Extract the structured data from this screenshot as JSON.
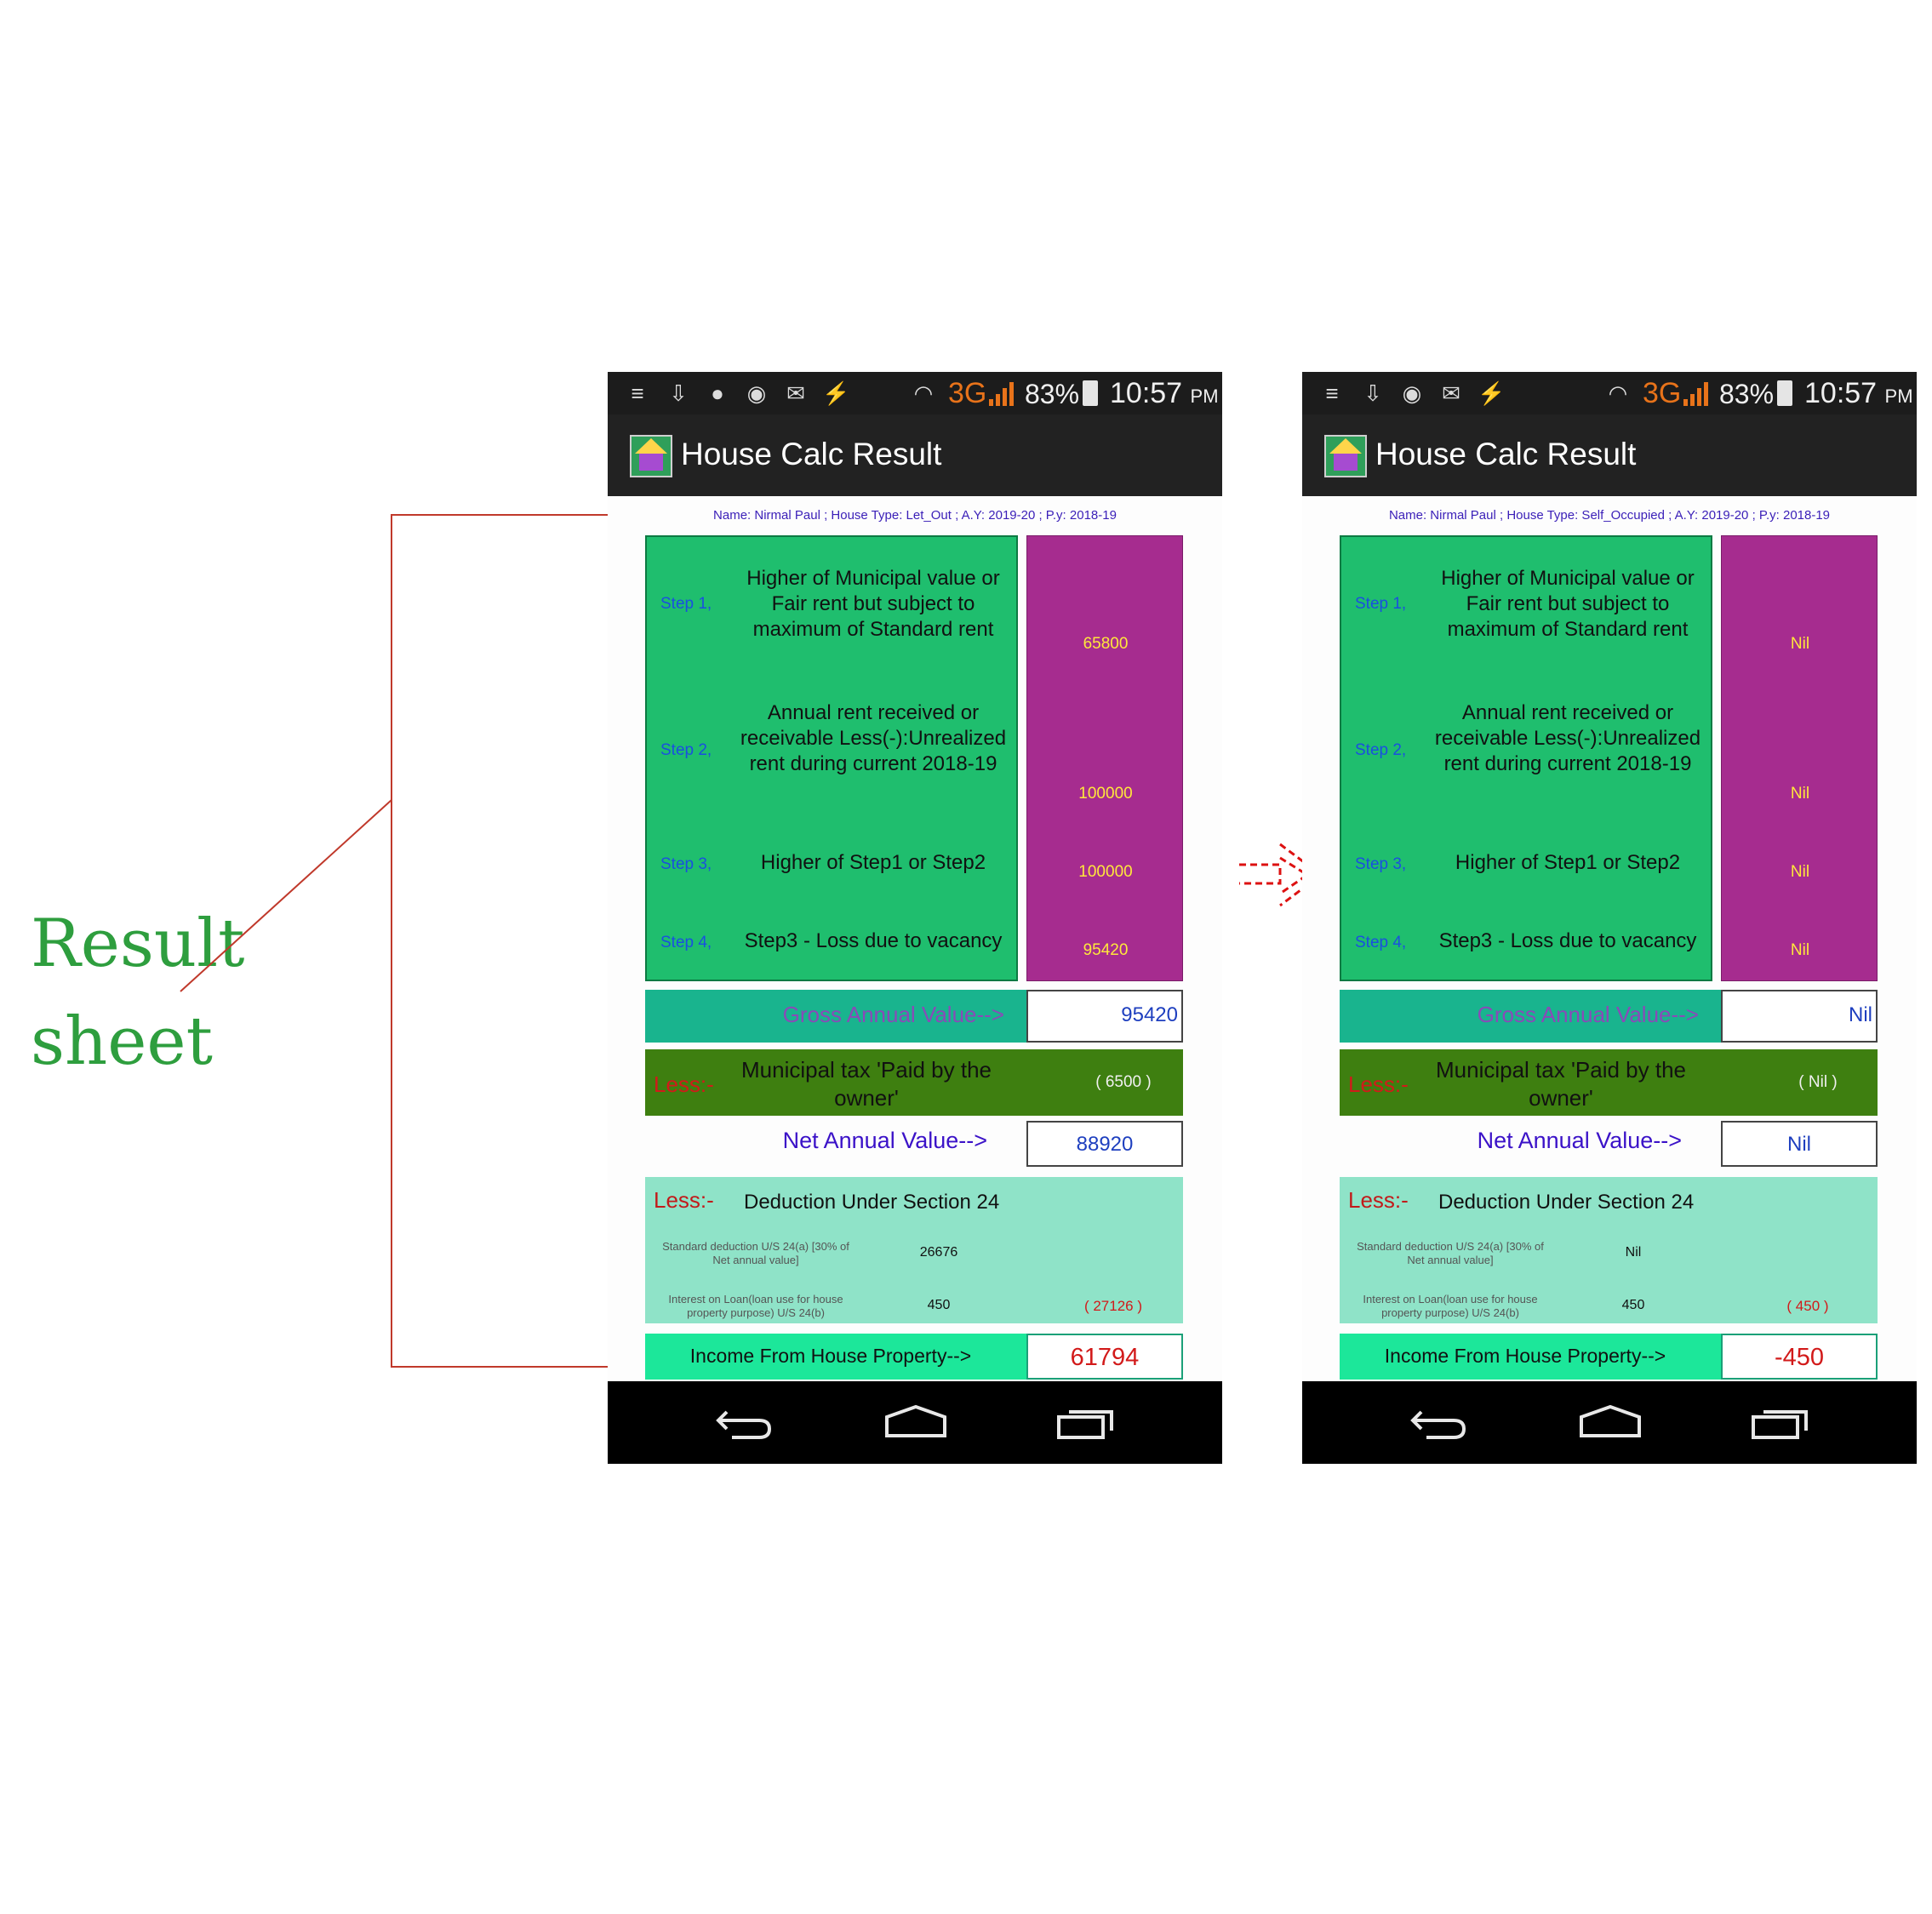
{
  "annotation": {
    "line1": "Result",
    "line2": "sheet"
  },
  "colors": {
    "accent_green": "#2e9e3e",
    "bracket_red": "#c0392b",
    "step_box": "#1fbe6e",
    "value_box": "#a62c8f"
  },
  "screens": [
    {
      "status": {
        "network": "3G",
        "battery": "83%",
        "time": "10:57",
        "ampm": "PM"
      },
      "app_title": "House Calc Result",
      "info": "Name: Nirmal Paul ;  House Type: Let_Out ;   A.Y: 2019-20  ;  P.y: 2018-19",
      "steps": [
        {
          "label": "Step 1,",
          "desc": "Higher of Municipal value or Fair rent but subject to maximum of Standard rent",
          "value": "65800"
        },
        {
          "label": "Step 2,",
          "desc": "Annual rent received or receivable Less(-):Unrealized rent during current 2018-19",
          "value": "100000"
        },
        {
          "label": "Step 3,",
          "desc": "Higher of Step1 or Step2",
          "value": "100000"
        },
        {
          "label": "Step 4,",
          "desc": "Step3 - Loss due to vacancy",
          "value": "95420"
        }
      ],
      "gross_label": "Gross Annual Value-->",
      "gross_value": "95420",
      "less_label": "Less:-",
      "municipal_label": "Municipal tax 'Paid by the owner'",
      "municipal_value": "( 6500 )",
      "net_label": "Net Annual Value-->",
      "net_value": "88920",
      "deduction_title": "Deduction Under Section 24",
      "std_ded_label": "Standard deduction U/S 24(a) [30% of Net annual value]",
      "std_ded_value": "26676",
      "interest_label": "Interest on Loan(loan use for house property purpose) U/S 24(b)",
      "interest_value": "450",
      "deduction_total": "( 27126 )",
      "income_label": "Income From House Property-->",
      "income_value": "61794"
    },
    {
      "status": {
        "network": "3G",
        "battery": "83%",
        "time": "10:57",
        "ampm": "PM"
      },
      "app_title": "House Calc Result",
      "info": "Name: Nirmal Paul ;  House Type: Self_Occupied ;   A.Y: 2019-20  ;  P.y: 2018-19",
      "steps": [
        {
          "label": "Step 1,",
          "desc": "Higher of Municipal value or Fair rent but subject to maximum of Standard rent",
          "value": "Nil"
        },
        {
          "label": "Step 2,",
          "desc": "Annual rent received or receivable Less(-):Unrealized rent during current 2018-19",
          "value": "Nil"
        },
        {
          "label": "Step 3,",
          "desc": "Higher of Step1 or Step2",
          "value": "Nil"
        },
        {
          "label": "Step 4,",
          "desc": "Step3 - Loss due to vacancy",
          "value": "Nil"
        }
      ],
      "gross_label": "Gross Annual Value-->",
      "gross_value": "Nil",
      "less_label": "Less:-",
      "municipal_label": "Municipal tax 'Paid by the owner'",
      "municipal_value": "( Nil )",
      "net_label": "Net Annual Value-->",
      "net_value": "Nil",
      "deduction_title": "Deduction Under Section 24",
      "std_ded_label": "Standard deduction U/S 24(a) [30% of Net annual value]",
      "std_ded_value": "Nil",
      "interest_label": "Interest on Loan(loan use for house property purpose) U/S 24(b)",
      "interest_value": "450",
      "deduction_total": "( 450 )",
      "income_label": "Income From House Property-->",
      "income_value": "-450"
    }
  ]
}
